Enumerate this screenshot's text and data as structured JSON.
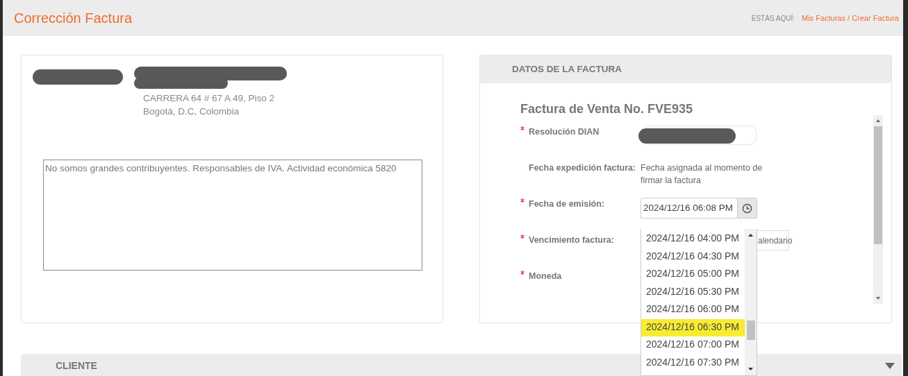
{
  "header": {
    "title": "Corrección Factura",
    "breadcrumb_label": "ESTÁS AQUÍ:",
    "breadcrumb": "Mis Facturas / Crear Factura"
  },
  "company": {
    "name_redacted": true,
    "address_lines": [
      "CARRERA 64 # 67 A 49, Piso 2",
      "Bogotá, D.C, Colombia"
    ],
    "notes": "No somos grandes contribuyentes. Responsables de IVA. Actividad económica 5820"
  },
  "invoice_panel": {
    "title": "DATOS DE LA FACTURA",
    "heading": "Factura de Venta No. FVE935",
    "fields": [
      {
        "kind": "redacted",
        "label": "Resolución DIAN",
        "required": true
      },
      {
        "kind": "text",
        "label": "Fecha expedición factura:",
        "required": false,
        "value": "Fecha asignada al momento de firmar la factura"
      },
      {
        "kind": "datetime",
        "label": "Fecha de emisión:",
        "required": true,
        "value": "2024/12/16 06:08 PM"
      },
      {
        "kind": "partial",
        "label": "Vencimiento factura:",
        "required": true,
        "value": "alendario"
      },
      {
        "kind": "empty",
        "label": "Moneda",
        "required": true
      }
    ]
  },
  "time_dropdown": [
    {
      "label": "2024/12/16 04:00 PM",
      "selected": false
    },
    {
      "label": "2024/12/16 04:30 PM",
      "selected": false
    },
    {
      "label": "2024/12/16 05:00 PM",
      "selected": false
    },
    {
      "label": "2024/12/16 05:30 PM",
      "selected": false
    },
    {
      "label": "2024/12/16 06:00 PM",
      "selected": false
    },
    {
      "label": "2024/12/16 06:30 PM",
      "selected": true
    },
    {
      "label": "2024/12/16 07:00 PM",
      "selected": false
    },
    {
      "label": "2024/12/16 07:30 PM",
      "selected": false
    }
  ],
  "client_section": {
    "title": "CLIENTE",
    "expanded": false
  }
}
